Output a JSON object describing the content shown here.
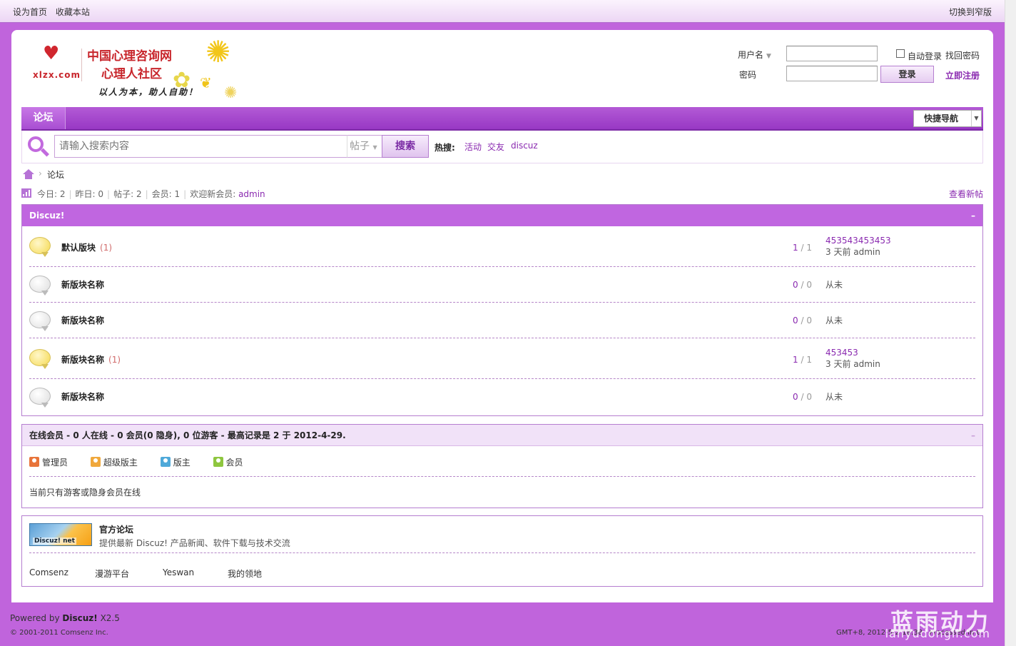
{
  "topbar": {
    "left_links": [
      "设为首页",
      "收藏本站"
    ],
    "right_link": "切换到窄版"
  },
  "logo": {
    "title1": "中国心理咨询网",
    "title2": "心理人社区",
    "site": "xlzx.com",
    "slogan": "以人为本，助人自助！"
  },
  "login": {
    "username_label": "用户名",
    "password_label": "密码",
    "auto_login": "自动登录",
    "login_button": "登录",
    "find_password": "找回密码",
    "register": "立即注册"
  },
  "nav": {
    "tab": "论坛",
    "quick_nav": "快捷导航"
  },
  "search": {
    "placeholder": "请输入搜索内容",
    "type": "帖子",
    "button": "搜索",
    "hot_label": "热搜:",
    "hot_links": [
      "活动",
      "交友",
      "discuz"
    ]
  },
  "breadcrumb": {
    "current": "论坛"
  },
  "stats": {
    "today": "今日: 2",
    "yesterday": "昨日: 0",
    "posts": "帖子: 2",
    "members": "会员: 1",
    "welcome": "欢迎新会员:",
    "new_member": "admin",
    "new_posts_link": "查看新帖"
  },
  "forum_group": {
    "title": "Discuz!",
    "collapse": "–",
    "forums": [
      {
        "name": "默认版块",
        "count": "(1)",
        "threads": "1",
        "posts": "1",
        "last_title": "453543453453",
        "last_meta": "3 天前  admin",
        "new": true
      },
      {
        "name": "新版块名称",
        "count": "",
        "threads": "0",
        "posts": "0",
        "last_text": "从未",
        "new": false
      },
      {
        "name": "新版块名称",
        "count": "",
        "threads": "0",
        "posts": "0",
        "last_text": "从未",
        "new": false
      },
      {
        "name": "新版块名称",
        "count": "(1)",
        "threads": "1",
        "posts": "1",
        "last_title": "453453",
        "last_meta": "3 天前  admin",
        "new": true
      },
      {
        "name": "新版块名称",
        "count": "",
        "threads": "0",
        "posts": "0",
        "last_text": "从未",
        "new": false
      }
    ]
  },
  "online": {
    "title": "在线会员  - 0 人在线  - 0 会员(0 隐身), 0 位游客  - 最高记录是  2 于  2012-4-29.",
    "dash": "–",
    "legend": [
      {
        "label": "管理员",
        "color": "#e8743a"
      },
      {
        "label": "超级版主",
        "color": "#f0a83c"
      },
      {
        "label": "版主",
        "color": "#4fa9d9"
      },
      {
        "label": "会员",
        "color": "#8ec63f"
      }
    ],
    "message": "当前只有游客或隐身会员在线"
  },
  "links": {
    "logo_text": "Discuz! net",
    "title": "官方论坛",
    "desc": "提供最新  Discuz! 产品新闻、软件下载与技术交流",
    "items": [
      "Comsenz",
      "漫游平台",
      "Yeswan",
      "我的领地"
    ]
  },
  "footer": {
    "powered_prefix": "Powered by",
    "powered_name": "Discuz!",
    "version": "X2.5",
    "copyright": "© 2001-2011 Comsenz Inc.",
    "gmt": "GMT+8, 2012-5-2 18:38 , Processed in 0.",
    "watermark1": "蓝雨动力",
    "watermark2": "lanyudongli.com"
  }
}
